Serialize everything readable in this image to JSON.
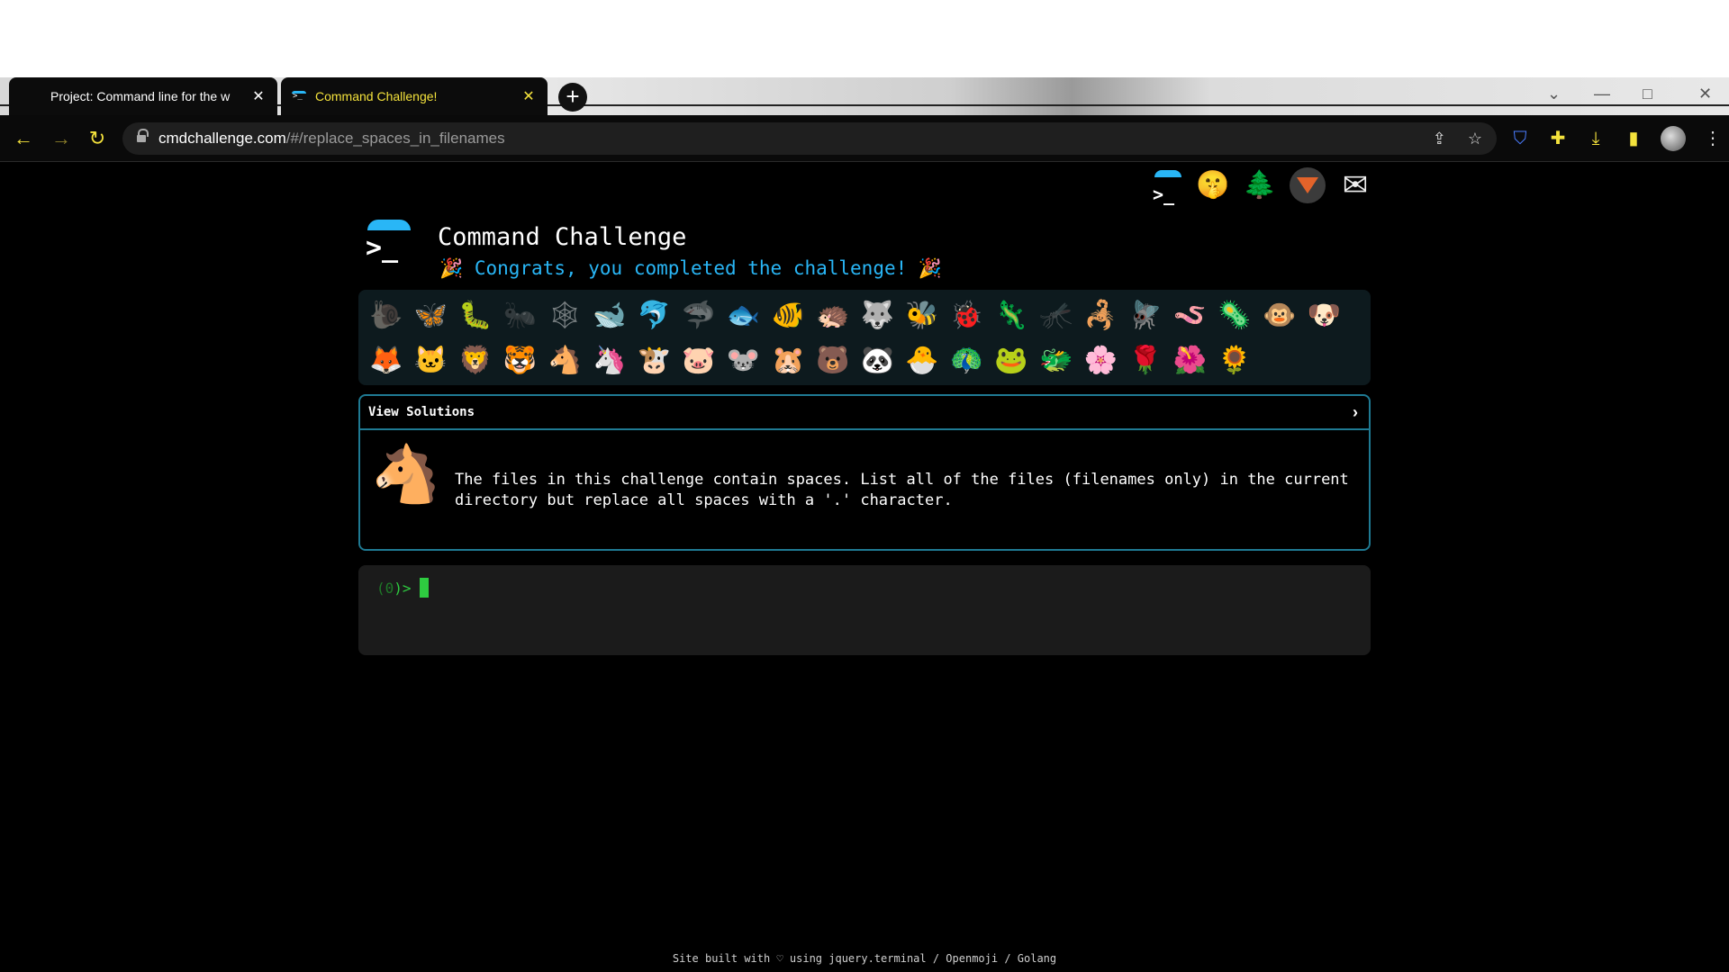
{
  "browser": {
    "tabs": [
      {
        "title": "Project: Command line for the w"
      },
      {
        "title": "Command Challenge!"
      }
    ],
    "url_host": "cmdchallenge.com",
    "url_path": "/#/replace_spaces_in_filenames"
  },
  "colors": {
    "accent": "#29b6f6",
    "prompt_green": "#2ecc40",
    "tab_active_text": "#f4e23c",
    "panel_border": "#1f7a93"
  },
  "top_links": [
    {
      "icon": "cmdchallenge-logo-icon"
    },
    {
      "icon": "shushing-face-icon",
      "glyph": "🤫"
    },
    {
      "icon": "tree-icon",
      "glyph": "🌲"
    },
    {
      "icon": "gitlab-icon"
    },
    {
      "icon": "envelope-icon",
      "glyph": "✉"
    }
  ],
  "header": {
    "title": "Command Challenge",
    "congrats": "Congrats, you completed the challenge!",
    "party_glyph": "🎉"
  },
  "animals": [
    {
      "name": "snail",
      "glyph": "🐌",
      "dim": true
    },
    {
      "name": "butterfly",
      "glyph": "🦋",
      "dim": false
    },
    {
      "name": "bug",
      "glyph": "🐛",
      "dim": false
    },
    {
      "name": "ant",
      "glyph": "🐜",
      "dim": true
    },
    {
      "name": "spider-web",
      "glyph": "🕸",
      "dim": true
    },
    {
      "name": "whale",
      "glyph": "🐋",
      "dim": false
    },
    {
      "name": "dolphin",
      "glyph": "🐬",
      "dim": false
    },
    {
      "name": "shark",
      "glyph": "🦈",
      "dim": true
    },
    {
      "name": "fish",
      "glyph": "🐟",
      "dim": false
    },
    {
      "name": "tropical-fish",
      "glyph": "🐠",
      "dim": false
    },
    {
      "name": "hedgehog",
      "glyph": "🦔",
      "dim": false
    },
    {
      "name": "wolf",
      "glyph": "🐺",
      "dim": false
    },
    {
      "name": "bee",
      "glyph": "🐝",
      "dim": false
    },
    {
      "name": "lady-beetle",
      "glyph": "🐞",
      "dim": false
    },
    {
      "name": "lizard",
      "glyph": "🦎",
      "dim": false
    },
    {
      "name": "mosquito",
      "glyph": "🦟",
      "dim": true
    },
    {
      "name": "scorpion",
      "glyph": "🦂",
      "dim": false
    },
    {
      "name": "fly",
      "glyph": "🪰",
      "dim": false
    },
    {
      "name": "worm",
      "glyph": "🪱",
      "dim": false
    },
    {
      "name": "microbe",
      "glyph": "🦠",
      "dim": false
    },
    {
      "name": "monkey-face",
      "glyph": "🐵",
      "dim": false
    },
    {
      "name": "dog-face",
      "glyph": "🐶",
      "dim": false
    },
    {
      "name": "fox",
      "glyph": "🦊",
      "dim": false
    },
    {
      "name": "cat-face",
      "glyph": "🐱",
      "dim": false
    },
    {
      "name": "lion",
      "glyph": "🦁",
      "dim": false
    },
    {
      "name": "tiger-face",
      "glyph": "🐯",
      "dim": false
    },
    {
      "name": "horse-face",
      "glyph": "🐴",
      "dim": false
    },
    {
      "name": "unicorn",
      "glyph": "🦄",
      "dim": false
    },
    {
      "name": "cow-face",
      "glyph": "🐮",
      "dim": false
    },
    {
      "name": "pig-face",
      "glyph": "🐷",
      "dim": false
    },
    {
      "name": "mouse-face",
      "glyph": "🐭",
      "dim": false
    },
    {
      "name": "hamster",
      "glyph": "🐹",
      "dim": false
    },
    {
      "name": "bear",
      "glyph": "🐻",
      "dim": false
    },
    {
      "name": "panda",
      "glyph": "🐼",
      "dim": false
    },
    {
      "name": "hatching-chick",
      "glyph": "🐣",
      "dim": false
    },
    {
      "name": "peacock",
      "glyph": "🦚",
      "dim": false
    },
    {
      "name": "frog",
      "glyph": "🐸",
      "dim": false
    },
    {
      "name": "dragon-face",
      "glyph": "🐲",
      "dim": false
    },
    {
      "name": "cherry-blossom",
      "glyph": "🌸",
      "dim": false
    },
    {
      "name": "rose",
      "glyph": "🌹",
      "dim": false
    },
    {
      "name": "hibiscus",
      "glyph": "🌺",
      "dim": false
    },
    {
      "name": "sunflower",
      "glyph": "🌻",
      "dim": false
    }
  ],
  "challenge": {
    "view_solutions_label": "View Solutions",
    "chevron": "›",
    "horse_glyph": "🐴",
    "description": "The files in this challenge contain spaces. List all of the files (filenames only) in the current directory but replace all spaces with a '.' character."
  },
  "terminal": {
    "prompt_open": "(",
    "prompt_num": "0",
    "prompt_close": ")>"
  },
  "footer": {
    "text": "Site built with ♡ using jquery.terminal / Openmoji / Golang"
  }
}
